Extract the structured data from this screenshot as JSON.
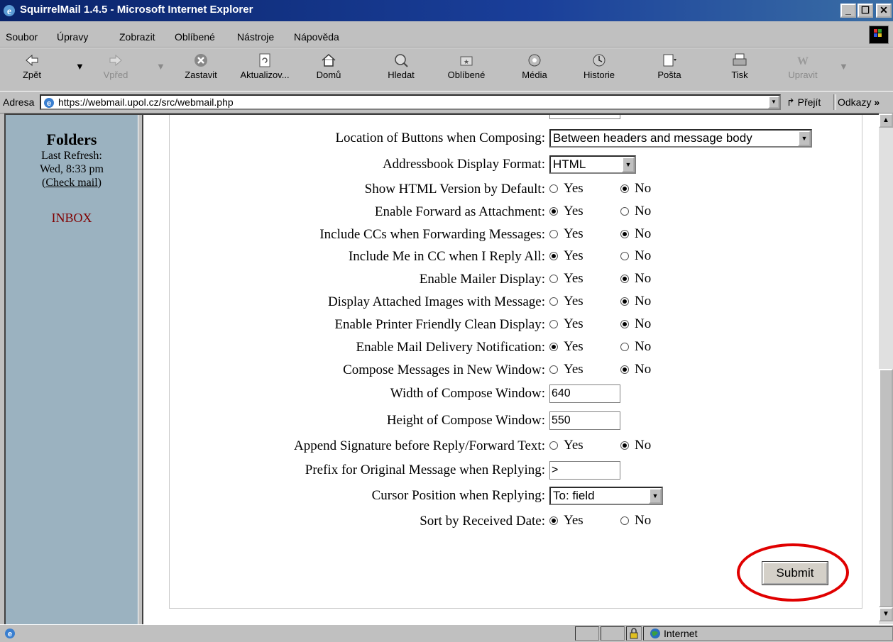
{
  "window": {
    "title": "SquirrelMail 1.4.5 - Microsoft Internet Explorer",
    "buttons": {
      "minimize": "_",
      "maximize": "☐",
      "close": "✕"
    }
  },
  "menu": [
    "Soubor",
    "Úpravy",
    "Zobrazit",
    "Oblíbené",
    "Nástroje",
    "Nápověda"
  ],
  "toolbar": {
    "back": "Zpět",
    "forward": "Vpřed",
    "stop": "Zastavit",
    "refresh": "Aktualizov...",
    "home": "Domů",
    "search": "Hledat",
    "favorites": "Oblíbené",
    "media": "Média",
    "history": "Historie",
    "mail": "Pošta",
    "print": "Tisk",
    "edit": "Upravit"
  },
  "address": {
    "label": "Adresa",
    "url": "https://webmail.upol.cz/src/webmail.php",
    "go": "Přejít",
    "links": "Odkazy"
  },
  "sidebar": {
    "title": "Folders",
    "last_refresh_label": "Last Refresh:",
    "last_refresh_time": "Wed, 8:33 pm",
    "check_mail": "Check mail",
    "inbox": "INBOX"
  },
  "options": {
    "location_buttons": {
      "label": "Location of Buttons when Composing:",
      "value": "Between headers and message body"
    },
    "addressbook_format": {
      "label": "Addressbook Display Format:",
      "value": "HTML"
    },
    "show_html": {
      "label": "Show HTML Version by Default:",
      "selected": "No"
    },
    "forward_attachment": {
      "label": "Enable Forward as Attachment:",
      "selected": "Yes"
    },
    "include_ccs": {
      "label": "Include CCs when Forwarding Messages:",
      "selected": "No"
    },
    "include_me_cc": {
      "label": "Include Me in CC when I Reply All:",
      "selected": "Yes"
    },
    "mailer_display": {
      "label": "Enable Mailer Display:",
      "selected": "No"
    },
    "attached_images": {
      "label": "Display Attached Images with Message:",
      "selected": "No"
    },
    "printer_friendly": {
      "label": "Enable Printer Friendly Clean Display:",
      "selected": "No"
    },
    "delivery_notification": {
      "label": "Enable Mail Delivery Notification:",
      "selected": "Yes"
    },
    "compose_new_window": {
      "label": "Compose Messages in New Window:",
      "selected": "No"
    },
    "compose_width": {
      "label": "Width of Compose Window:",
      "value": "640"
    },
    "compose_height": {
      "label": "Height of Compose Window:",
      "value": "550"
    },
    "sig_before_reply": {
      "label": "Append Signature before Reply/Forward Text:",
      "selected": "No"
    },
    "prefix_original": {
      "label": "Prefix for Original Message when Replying:",
      "value": ">"
    },
    "cursor_position": {
      "label": "Cursor Position when Replying:",
      "value": "To: field"
    },
    "sort_received": {
      "label": "Sort by Received Date:",
      "selected": "Yes"
    }
  },
  "radio_labels": {
    "yes": "Yes",
    "no": "No"
  },
  "submit_label": "Submit",
  "status": {
    "zone": "Internet"
  },
  "colors": {
    "sidebar_bg": "#9bb2c0",
    "inbox_link": "#800000",
    "highlight_circle": "#e00000",
    "titlebar": "#0a246a"
  }
}
